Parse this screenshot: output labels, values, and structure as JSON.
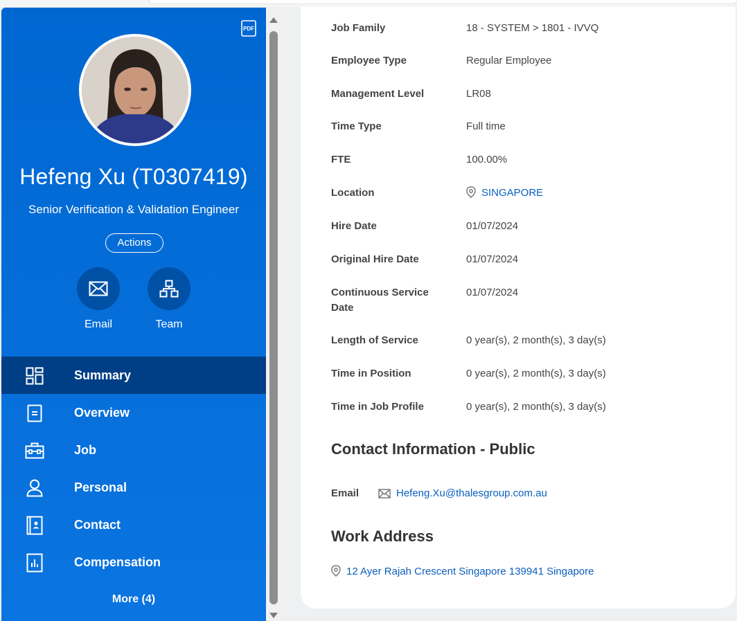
{
  "profile": {
    "name": "Hefeng Xu (T0307419)",
    "title": "Senior Verification & Validation Engineer",
    "actions_label": "Actions",
    "pdf_label": "PDF",
    "quick_actions": [
      {
        "label": "Email",
        "icon": "envelope-icon"
      },
      {
        "label": "Team",
        "icon": "org-chart-icon"
      }
    ]
  },
  "nav": {
    "items": [
      {
        "label": "Summary",
        "icon": "dashboard-icon",
        "active": true
      },
      {
        "label": "Overview",
        "icon": "document-icon"
      },
      {
        "label": "Job",
        "icon": "briefcase-icon"
      },
      {
        "label": "Personal",
        "icon": "person-icon"
      },
      {
        "label": "Contact",
        "icon": "contact-card-icon"
      },
      {
        "label": "Compensation",
        "icon": "bar-chart-icon"
      }
    ],
    "more_label": "More (4)"
  },
  "details": [
    {
      "label": "Job Family",
      "value": "18 - SYSTEM > 1801 - IVVQ"
    },
    {
      "label": "Employee Type",
      "value": "Regular Employee"
    },
    {
      "label": "Management Level",
      "value": "LR08"
    },
    {
      "label": "Time Type",
      "value": "Full time"
    },
    {
      "label": "FTE",
      "value": "100.00%"
    },
    {
      "label": "Location",
      "value": "SINGAPORE"
    },
    {
      "label": "Hire Date",
      "value": "01/07/2024"
    },
    {
      "label": "Original Hire Date",
      "value": "01/07/2024"
    },
    {
      "label": "Continuous Service Date",
      "value": "01/07/2024"
    },
    {
      "label": "Length of Service",
      "value": "0 year(s), 2 month(s), 3 day(s)"
    },
    {
      "label": "Time in Position",
      "value": "0 year(s), 2 month(s), 3 day(s)"
    },
    {
      "label": "Time in Job Profile",
      "value": "0 year(s), 2 month(s), 3 day(s)"
    }
  ],
  "contact": {
    "heading": "Contact Information - Public",
    "email_label": "Email",
    "email_value": "Hefeng.Xu@thalesgroup.com.au"
  },
  "work_address": {
    "heading": "Work Address",
    "address": "12 Ayer Rajah Crescent Singapore 139941 Singapore"
  },
  "colors": {
    "sidebar": "#0067d1",
    "sidebar_active": "#003f85",
    "link": "#0b5fbf"
  }
}
